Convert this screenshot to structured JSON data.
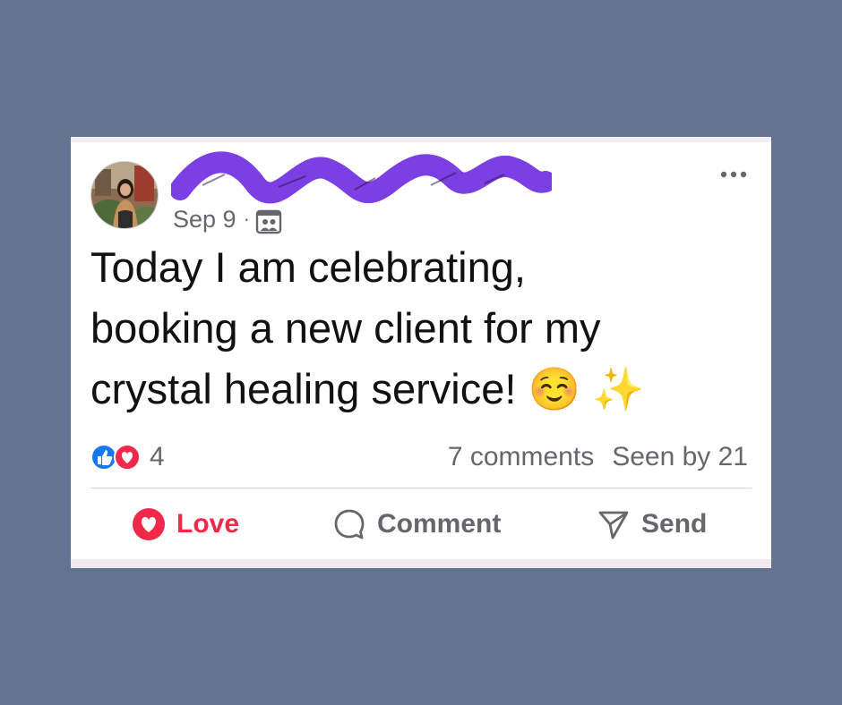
{
  "post": {
    "author_name": "",
    "date": "Sep 9",
    "separator": "·",
    "audience_icon": "group-audience-icon",
    "text_lines": [
      "Today I am celebrating,",
      "booking a new client for my",
      "crystal healing service! ☺️ ✨"
    ]
  },
  "engagement": {
    "reaction_icons": [
      "like-icon",
      "love-reaction-icon"
    ],
    "reaction_count": "4",
    "comments": "7 comments",
    "seen_by": "Seen by 21"
  },
  "actions": {
    "love_label": "Love",
    "comment_label": "Comment",
    "send_label": "Send"
  },
  "colors": {
    "background": "#637490",
    "love_red": "#f0284a",
    "like_blue": "#1877f2",
    "redaction_purple": "#7b3fe4",
    "muted_text": "#65676b"
  }
}
